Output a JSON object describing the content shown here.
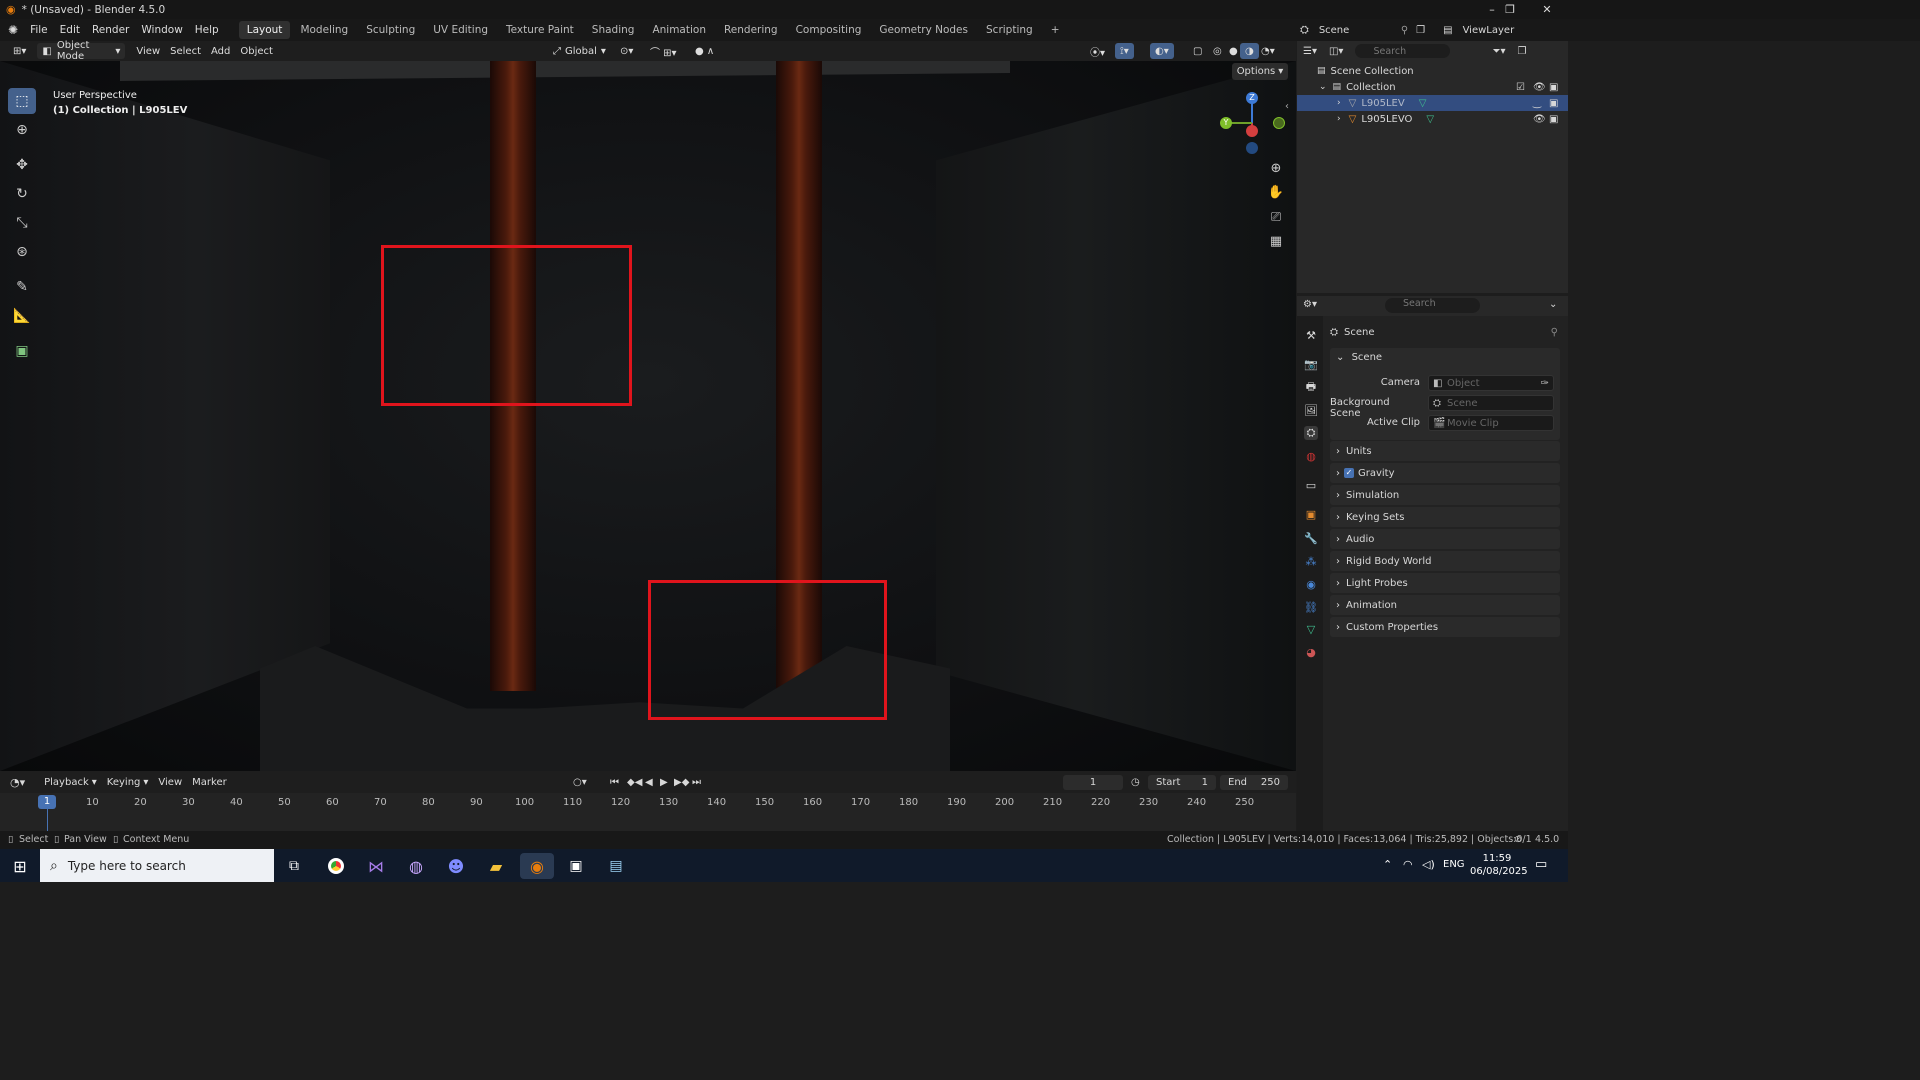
{
  "title_bar": {
    "title": "* (Unsaved) - Blender 4.5.0",
    "minimize": "–",
    "maximize": "❐",
    "close": "✕"
  },
  "menus": [
    "File",
    "Edit",
    "Render",
    "Window",
    "Help"
  ],
  "workspaces": [
    {
      "label": "Layout",
      "active": true
    },
    {
      "label": "Modeling"
    },
    {
      "label": "Sculpting"
    },
    {
      "label": "UV Editing"
    },
    {
      "label": "Texture Paint"
    },
    {
      "label": "Shading"
    },
    {
      "label": "Animation"
    },
    {
      "label": "Rendering"
    },
    {
      "label": "Compositing"
    },
    {
      "label": "Geometry Nodes"
    },
    {
      "label": "Scripting"
    }
  ],
  "header_right": {
    "scene": "Scene",
    "view_layer": "ViewLayer"
  },
  "viewport_header": {
    "mode": "Object Mode",
    "menus": [
      "View",
      "Select",
      "Add",
      "Object"
    ],
    "orientation": "Global",
    "options": "Options"
  },
  "viewport": {
    "perspective": "User Perspective",
    "collection_info": "(1) Collection | L905LEV",
    "gizmo_axes": {
      "z": "Z",
      "y": "Y",
      "x": "X"
    }
  },
  "outliner": {
    "search_placeholder": "Search",
    "scene_collection": "Scene Collection",
    "collection": "Collection",
    "objects": [
      {
        "name": "L905LEV",
        "selected": true
      },
      {
        "name": "L905LEVO",
        "selected": false
      }
    ]
  },
  "properties": {
    "search_placeholder": "Search",
    "header": "Scene",
    "scene_panel": {
      "title": "Scene",
      "camera_label": "Camera",
      "camera_placeholder": "Object",
      "background_label": "Background Scene",
      "background_placeholder": "Scene",
      "clip_label": "Active Clip",
      "clip_placeholder": "Movie Clip"
    },
    "panels": [
      "Units",
      "Gravity",
      "Simulation",
      "Keying Sets",
      "Audio",
      "Rigid Body World",
      "Light Probes",
      "Animation",
      "Custom Properties"
    ]
  },
  "timeline": {
    "menus": [
      "Playback",
      "Keying",
      "View",
      "Marker"
    ],
    "current_frame": "1",
    "start_label": "Start",
    "start": "1",
    "end_label": "End",
    "end": "250",
    "ticks": [
      "1",
      "10",
      "20",
      "30",
      "40",
      "50",
      "60",
      "70",
      "80",
      "90",
      "100",
      "110",
      "120",
      "130",
      "140",
      "150",
      "160",
      "170",
      "180",
      "190",
      "200",
      "210",
      "220",
      "230",
      "240",
      "250"
    ]
  },
  "status_bar": {
    "select": "Select",
    "pan": "Pan View",
    "context": "Context Menu",
    "stats": "Collection | L905LEV | Verts:14,010 | Faces:13,064 | Tris:25,892 | Objects:0/1",
    "version": "4.5.0"
  },
  "taskbar": {
    "search_placeholder": "Type here to search",
    "language": "ENG",
    "time": "11:59",
    "date": "06/08/2025"
  },
  "colors": {
    "accent": "#4772b3",
    "highlight_box": "#e0141c",
    "active_tool": "#44618c"
  }
}
